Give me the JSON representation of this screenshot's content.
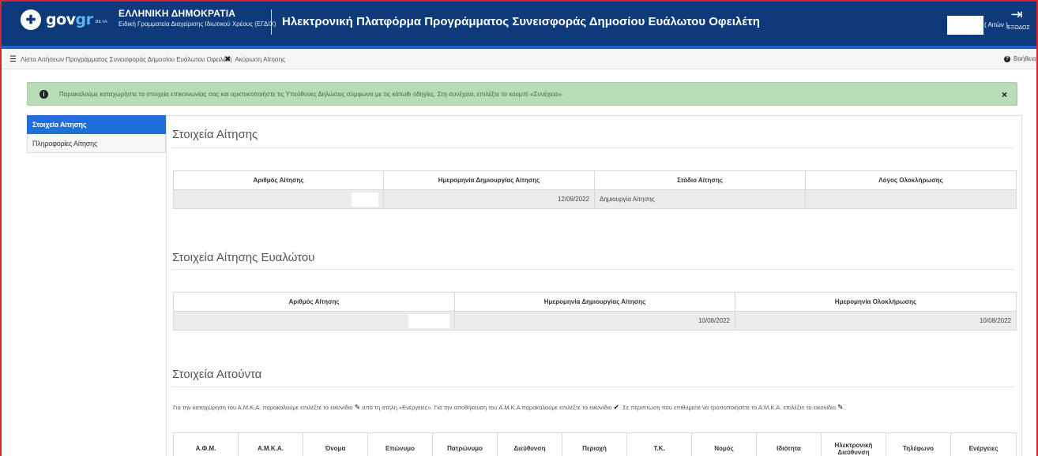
{
  "header": {
    "logo_main": "gov",
    "logo_accent": "gr",
    "logo_badge": "BETA",
    "gov_title": "ΕΛΛΗΝΙΚΗ ΔΗΜΟΚΡΑΤΙΑ",
    "gov_subtitle": "Ειδική Γραμματεία Διαχείρισης Ιδιωτικού Χρέους (ΕΓΔΙΧ)",
    "platform_title": "Ηλεκτρονική Πλατφόρμα Προγράμματος Συνεισφοράς Δημοσίου Ευάλωτου Οφειλέτη",
    "user_role": "( Αιτών )",
    "logout_label": "ΕΞΟΔΟΣ"
  },
  "toolbar": {
    "list_label": "Λίστα Αιτήσεων Προγράμματος Συνεισφοράς Δημοσίου Ευάλωτου Οφειλέτη",
    "cancel_label": "Ακύρωση Αίτησης",
    "help_label": "Βοήθεια"
  },
  "alert": {
    "message": "Παρακαλούμε καταχωρήστε τα στοιχεία επικοινωνίας σας και οριστικοποιήστε τις Υπεύθυνες Δηλώσεις σύμφωνα με τις κάτωθι οδηγίες. Στη συνέχεια, επιλέξτε το κουμπί «Συνέχεια».",
    "close": "×"
  },
  "sidebar": {
    "items": [
      {
        "label": "Στοιχεία Αίτησης"
      },
      {
        "label": "Πληροφορίες Αίτησης"
      }
    ]
  },
  "section1": {
    "title": "Στοιχεία Αίτησης",
    "headers": [
      "Αριθμός Αίτησης",
      "Ημερομηνία Δημιουργίας Αίτησης",
      "Στάδιο Αίτησης",
      "Λόγος Ολοκλήρωσης"
    ],
    "row": {
      "date": "12/09/2022",
      "stage": "Δημιουργία Αίτησης",
      "reason": ""
    }
  },
  "section2": {
    "title": "Στοιχεία Αίτησης Ευαλώτου",
    "headers": [
      "Αριθμός Αίτησης",
      "Ημερομηνία Δημιουργίας Αίτησης",
      "Ημερομηνία Ολοκλήρωσης"
    ],
    "row": {
      "created": "10/08/2022",
      "completed": "10/08/2022"
    }
  },
  "section3": {
    "title": "Στοιχεία Αιτούντα",
    "hint_a": "Για την καταχώρηση του Α.Μ.Κ.Α. παρακαλούμε επιλέξτε το εικονίδιο",
    "hint_b": "από τη στήλη «Ενέργειες». Για την αποθήκευση του Α.Μ.Κ.Α παρακαλούμε επιλέξτε το εικονίδιο",
    "hint_c": ". Σε περίπτωση που επιθυμείτε να τροποποιήσετε το Α.Μ.Κ.Α. επιλέξτε το εικονίδιο",
    "hint_d": ".",
    "headers": [
      "Α.Φ.Μ.",
      "Α.Μ.Κ.Α.",
      "Όνομα",
      "Επώνυμο",
      "Πατρώνυμο",
      "Διεύθυνση",
      "Περιοχή",
      "Τ.Κ.",
      "Νομός",
      "Ιδιότητα",
      "Ηλεκτρονική Διεύθυνση",
      "Τηλέφωνο",
      "Ενέργειες"
    ]
  },
  "colors": {
    "header_bg": "#0d3a7a",
    "accent": "#1e6fd9",
    "alert_bg": "#b8dcb8",
    "frame": "#d9232d"
  }
}
